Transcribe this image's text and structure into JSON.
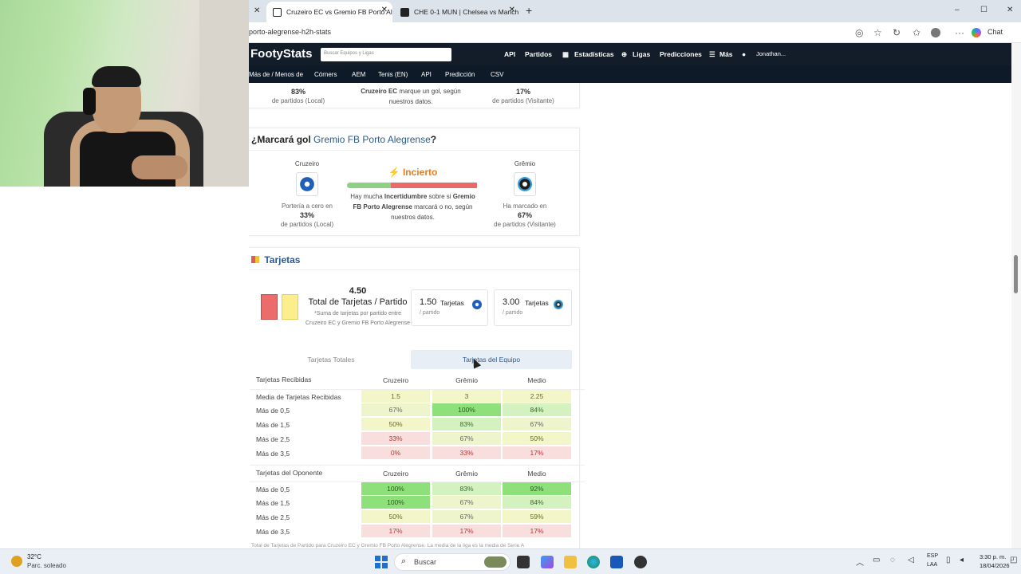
{
  "browser": {
    "tabs": [
      {
        "title": "Cruzeiro EC vs Gremio FB Porto Al",
        "active": true
      },
      {
        "title": "CHE 0-1 MUN | Chelsea vs Manch",
        "active": false
      }
    ],
    "new_tab": "+",
    "url": "porto-alegrense-h2h-stats",
    "chat_label": "Chat",
    "window_controls": {
      "minimize": "–",
      "maximize": "☐",
      "close": "✕"
    }
  },
  "site": {
    "logo": "FootyStats",
    "search_placeholder": "Buscar Equipos y Ligas",
    "nav": [
      "API",
      "Partidos",
      "Estadísticas",
      "Ligas",
      "Predicciones",
      "Más"
    ],
    "user": "Jonathan...",
    "subnav": [
      "Más de / Menos de",
      "Córners",
      "AEM",
      "Tenis (EN)",
      "API",
      "Predicción",
      "CSV"
    ]
  },
  "prev_card": {
    "left_pct": "83%",
    "left_caption": "de partidos (Local)",
    "mid_text_bold": "Cruzeiro EC",
    "mid_text": "marque un gol, según nuestros datos.",
    "right_pct": "17%",
    "right_caption": "de partidos (Visitante)"
  },
  "gol_card": {
    "title_prefix": "¿Marcará gol",
    "team_name": "Gremio FB Porto Alegrense",
    "title_suffix": "?",
    "home_name": "Cruzeiro",
    "away_name": "Grêmio",
    "verdict": "Incierto",
    "desc_1": "Hay mucha",
    "desc_bold": "Incertidumbre",
    "desc_2": "sobre si",
    "desc_team": "Gremio FB Porto Alegrense",
    "desc_3": "marcará o no, según nuestros datos.",
    "home_label": "Portería a cero en",
    "home_pct": "33%",
    "home_caption": "de partidos (Local)",
    "away_label": "Ha marcado en",
    "away_pct": "67%",
    "away_caption": "de partidos (Visitante)"
  },
  "cards_card": {
    "title": "Tarjetas",
    "total_value": "4.50",
    "total_label": "Total de Tarjetas / Partido",
    "total_note": "*Suma de tarjetas por partido entre Cruzeiro EC y Gremio FB Porto Alegrense",
    "home_value": "1.50",
    "home_unit": "Tarjetas",
    "home_per": "/ partido",
    "away_value": "3.00",
    "away_unit": "Tarjetas",
    "away_per": "/ partido",
    "tab_total": "Tarjetas Totales",
    "tab_team": "Tarjetas del Equipo",
    "table1": {
      "headers": [
        "Tarjetas Recibidas",
        "Cruzeiro",
        "Grêmio",
        "Medio"
      ],
      "rows": [
        [
          "Media de Tarjetas Recibidas",
          "1.5",
          "3",
          "2.25"
        ],
        [
          "Más de 0,5",
          "67%",
          "100%",
          "84%"
        ],
        [
          "Más de 1,5",
          "50%",
          "83%",
          "67%"
        ],
        [
          "Más de 2,5",
          "33%",
          "67%",
          "50%"
        ],
        [
          "Más de 3,5",
          "0%",
          "33%",
          "17%"
        ]
      ]
    },
    "table2": {
      "headers": [
        "Tarjetas del Oponente",
        "Cruzeiro",
        "Grêmio",
        "Medio"
      ],
      "rows": [
        [
          "Más de 0,5",
          "100%",
          "83%",
          "92%"
        ],
        [
          "Más de 1,5",
          "100%",
          "67%",
          "84%"
        ],
        [
          "Más de 2,5",
          "50%",
          "67%",
          "59%"
        ],
        [
          "Más de 3,5",
          "17%",
          "17%",
          "17%"
        ]
      ]
    },
    "footer_note": "Total de Tarjetas de Partido para Cruzeiro EC y Gremio FB Porto Alegrense. La media de la liga es la media de Serie A"
  },
  "taskbar": {
    "weather_temp": "32°C",
    "weather_desc": "Parc. soleado",
    "search": "Buscar",
    "lang": "ESP",
    "lang2": "LAA",
    "time": "3:30 p. m.",
    "date": "18/04/2026"
  }
}
